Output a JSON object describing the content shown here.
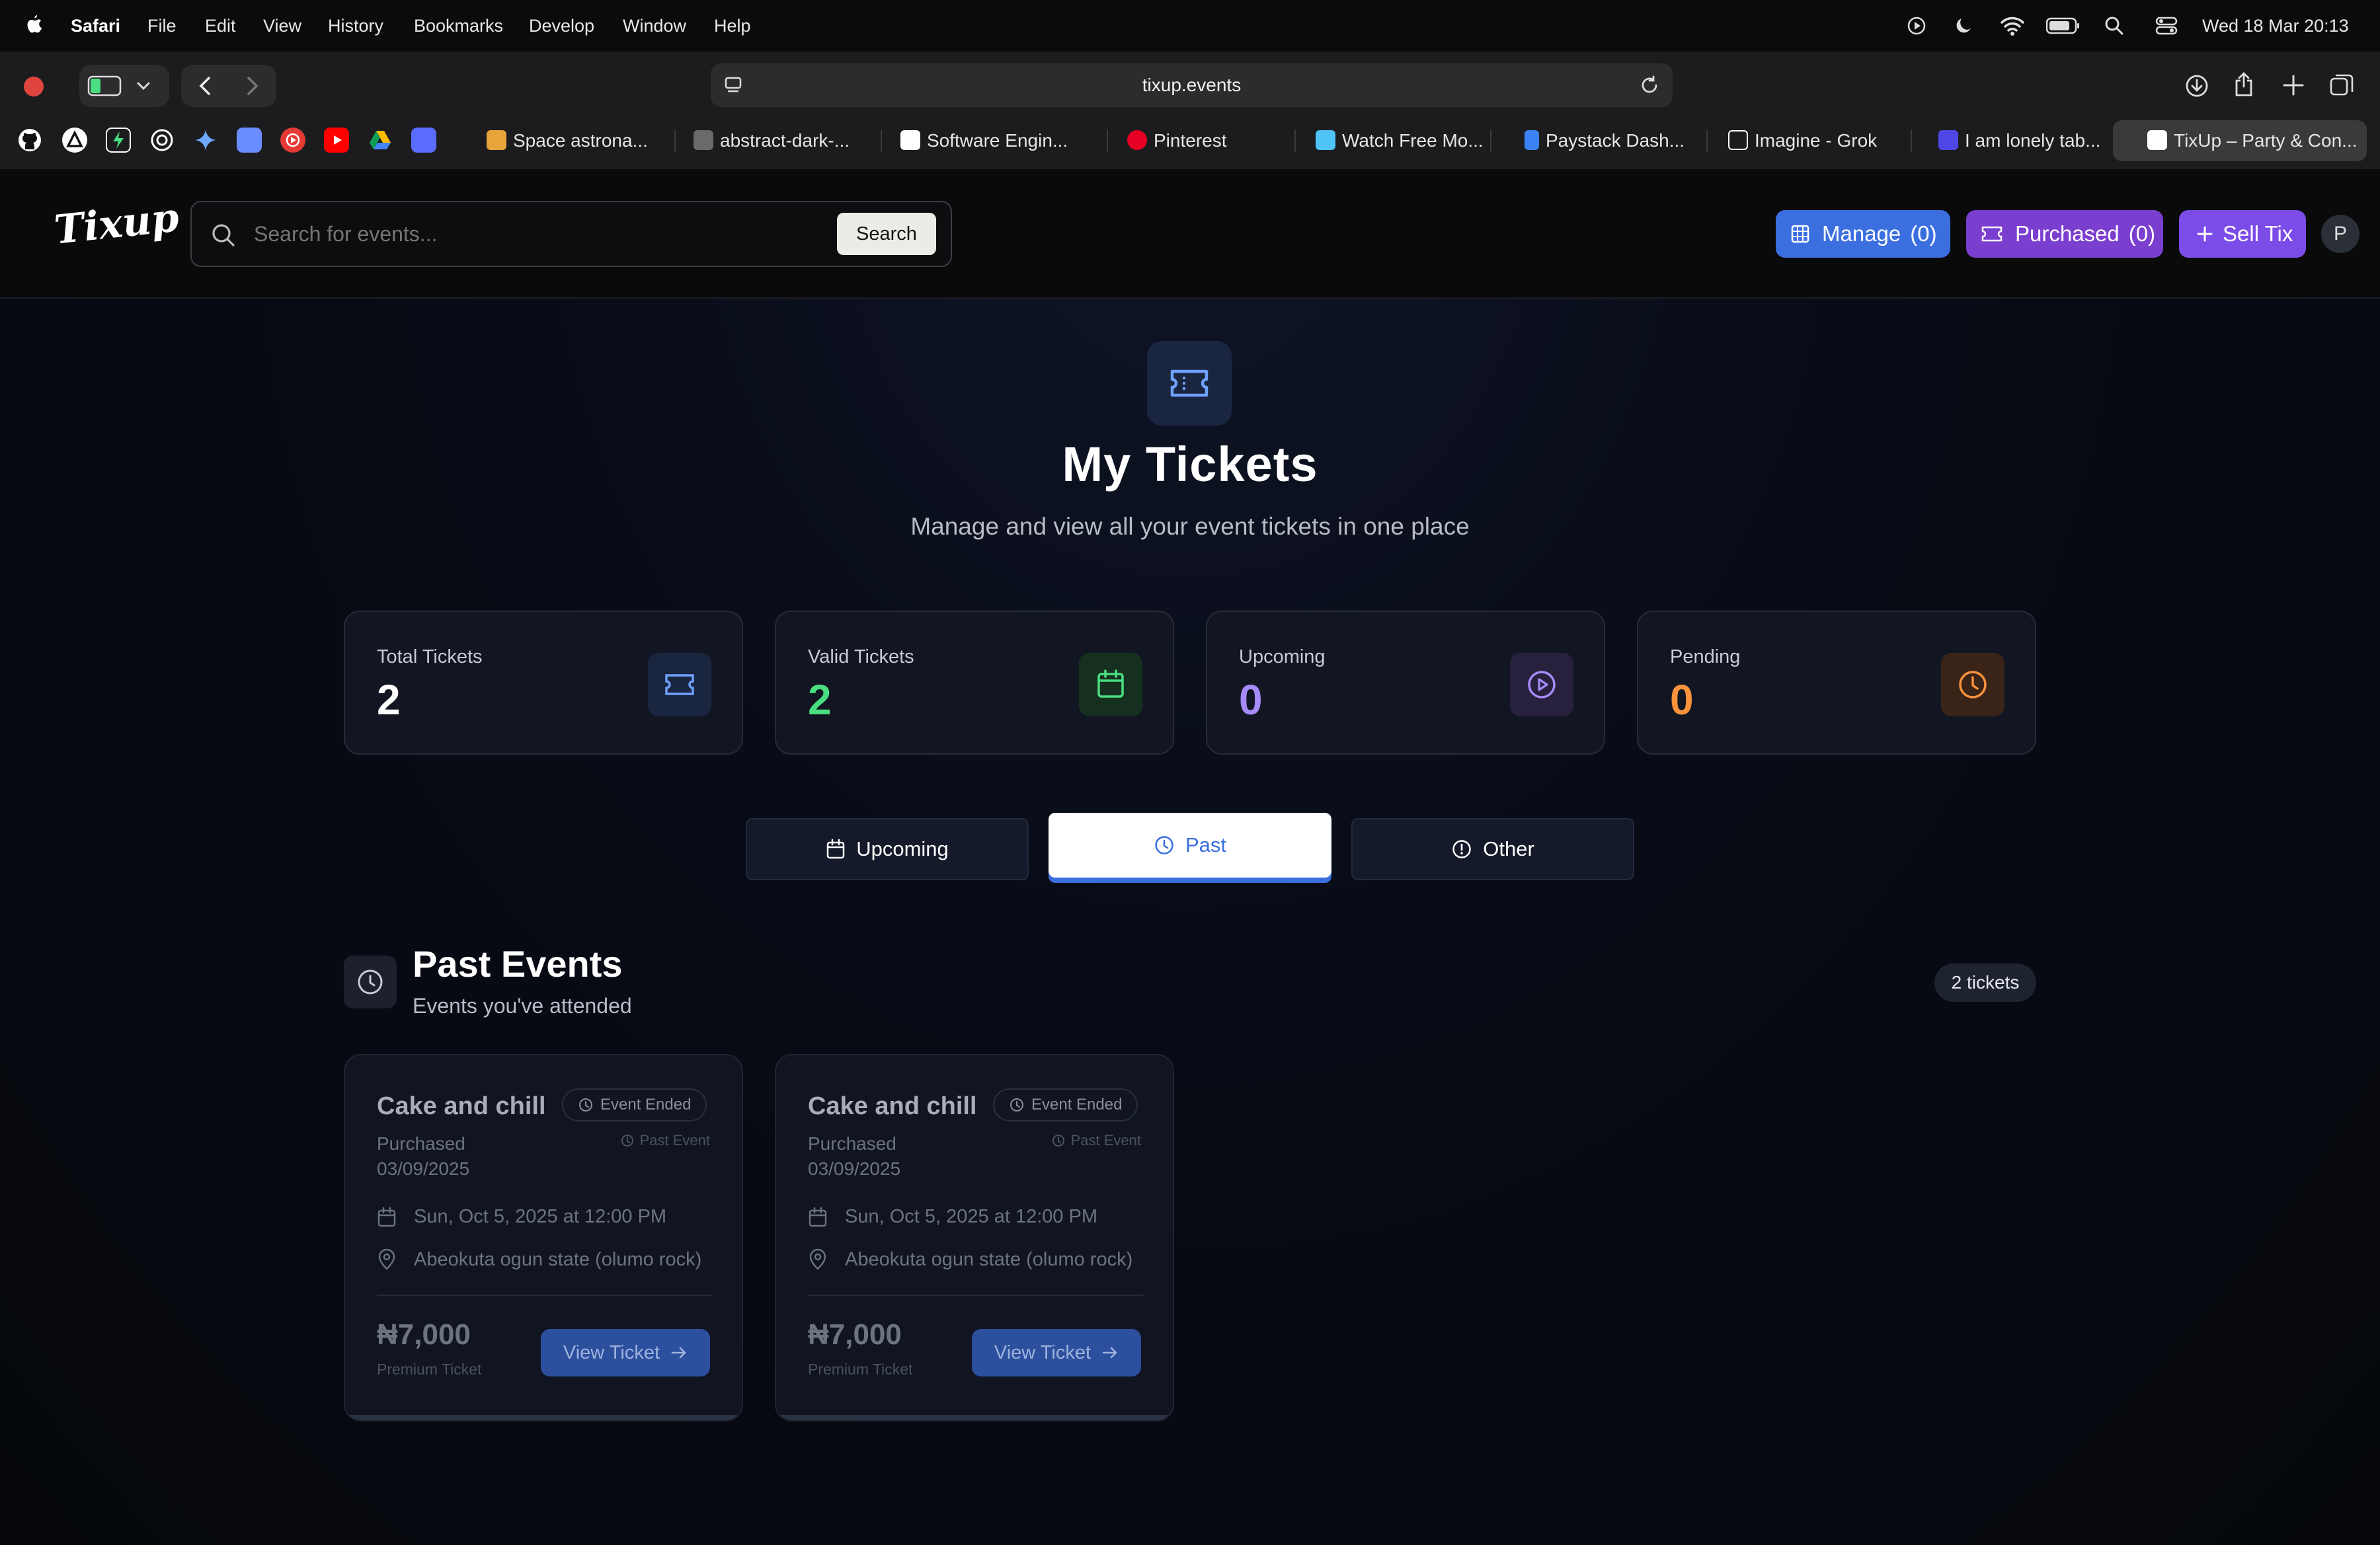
{
  "menubar": {
    "app_name": "Safari",
    "menus": [
      "File",
      "Edit",
      "View",
      "History",
      "Bookmarks",
      "Develop",
      "Window",
      "Help"
    ],
    "datetime": "Wed 18 Mar  20:13"
  },
  "browser": {
    "url": "tixup.events",
    "tabs": [
      {
        "label": "Space astrona...",
        "icon_color": "#e8a33b"
      },
      {
        "label": "abstract-dark-...",
        "icon_color": "#6a6a6a"
      },
      {
        "label": "Software Engin...",
        "icon_color": "#ffffff"
      },
      {
        "label": "Pinterest",
        "icon_color": "#e60023"
      },
      {
        "label": "Watch Free Mo...",
        "icon_color": "#4fc3f7"
      },
      {
        "label": "Paystack Dash...",
        "icon_color": "#3b82f6"
      },
      {
        "label": "Imagine - Grok",
        "icon_color": "#ffffff"
      },
      {
        "label": "I am lonely tab...",
        "icon_color": "#4f46e5"
      },
      {
        "label": "TixUp – Party & Con...",
        "icon_color": "#ffffff"
      }
    ]
  },
  "app": {
    "logo_text": "Tixup",
    "search_placeholder": "Search for events...",
    "search_button": "Search",
    "manage_label": "Manage",
    "manage_count": "(0)",
    "purchased_label": "Purchased",
    "purchased_count": "(0)",
    "sell_label": "Sell Tix",
    "avatar_initial": "P",
    "colors": {
      "manage": "#3b6fe0",
      "purchased": "#7b3fcf",
      "sell": "#7c4ce8"
    }
  },
  "hero": {
    "title": "My Tickets",
    "subtitle": "Manage and view all your event tickets in one place"
  },
  "stats": [
    {
      "label": "Total Tickets",
      "value": "2",
      "color": "#ffffff",
      "icon": "ticket-icon"
    },
    {
      "label": "Valid Tickets",
      "value": "2",
      "color": "#4ade80",
      "icon": "calendar-icon"
    },
    {
      "label": "Upcoming",
      "value": "0",
      "color": "#a78bfa",
      "icon": "play-circle-icon"
    },
    {
      "label": "Pending",
      "value": "0",
      "color": "#fb923c",
      "icon": "clock-icon"
    }
  ],
  "tabs": {
    "upcoming": "Upcoming",
    "past": "Past",
    "other": "Other",
    "active": "Past"
  },
  "section": {
    "title": "Past Events",
    "subtitle": "Events you've attended",
    "count_badge": "2 tickets"
  },
  "events": [
    {
      "title": "Cake and chill",
      "status": "Event Ended",
      "sub_status": "Past Event",
      "purchased_label": "Purchased",
      "purchased_date": "03/09/2025",
      "datetime": "Sun, Oct 5, 2025 at 12:00 PM",
      "location": "Abeokuta ogun state (olumo rock)",
      "price": "₦7,000",
      "ticket_type": "Premium Ticket",
      "button": "View Ticket"
    },
    {
      "title": "Cake and chill",
      "status": "Event Ended",
      "sub_status": "Past Event",
      "purchased_label": "Purchased",
      "purchased_date": "03/09/2025",
      "datetime": "Sun, Oct 5, 2025 at 12:00 PM",
      "location": "Abeokuta ogun state (olumo rock)",
      "price": "₦7,000",
      "ticket_type": "Premium Ticket",
      "button": "View Ticket"
    }
  ]
}
